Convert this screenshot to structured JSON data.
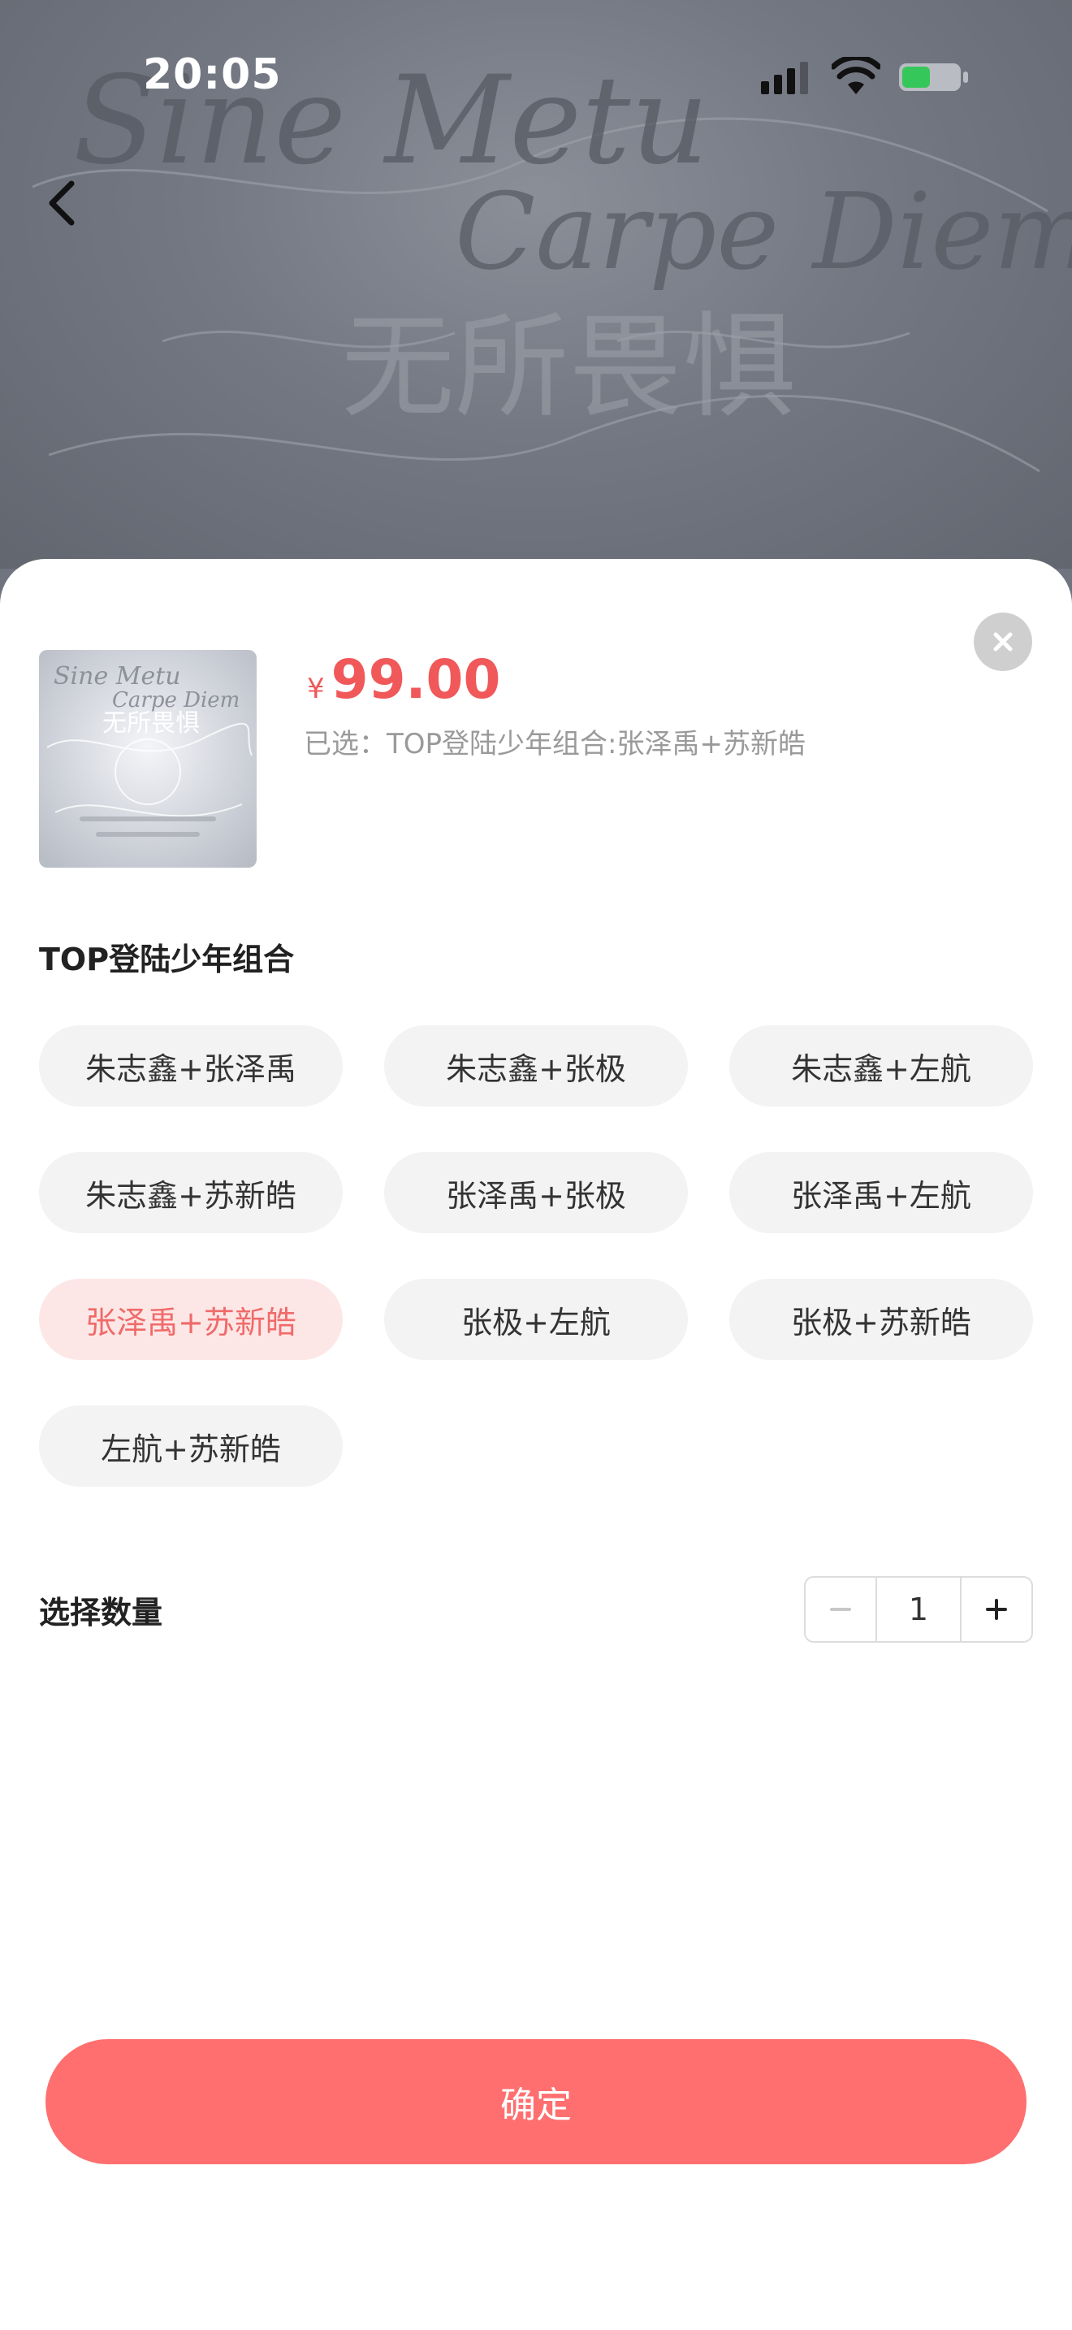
{
  "status_bar": {
    "time": "20:05",
    "icons": [
      "signal-icon",
      "wifi-icon",
      "battery-icon"
    ]
  },
  "header": {
    "back_icon": "chevron-left-icon",
    "background_art": {
      "title_lines": [
        "Sine Metu",
        "Carpe Diem"
      ],
      "chinese_title": "无所畏惧"
    }
  },
  "product": {
    "currency": "¥",
    "price": "99.00",
    "selected_text": "已选：TOP登陆少年组合:张泽禹+苏新皓",
    "thumbnail": {
      "title_lines": [
        "Sine Metu",
        "Carpe Diem"
      ],
      "chinese_title": "无所畏惧"
    }
  },
  "options": {
    "group_title": "TOP登陆少年组合",
    "items": [
      {
        "label": "朱志鑫+张泽禹",
        "selected": false
      },
      {
        "label": "朱志鑫+张极",
        "selected": false
      },
      {
        "label": "朱志鑫+左航",
        "selected": false
      },
      {
        "label": "朱志鑫+苏新皓",
        "selected": false
      },
      {
        "label": "张泽禹+张极",
        "selected": false
      },
      {
        "label": "张泽禹+左航",
        "selected": false
      },
      {
        "label": "张泽禹+苏新皓",
        "selected": true
      },
      {
        "label": "张极+左航",
        "selected": false
      },
      {
        "label": "张极+苏新皓",
        "selected": false
      },
      {
        "label": "左航+苏新皓",
        "selected": false
      }
    ]
  },
  "quantity": {
    "label": "选择数量",
    "value": "1",
    "minus_icon": "minus-icon",
    "plus_icon": "plus-icon"
  },
  "confirm_label": "确定",
  "colors": {
    "accent": "#ff6f6f",
    "price": "#f0585a",
    "selected_chip_bg": "#fde7e6",
    "selected_chip_text": "#f06a6a",
    "chip_bg": "#f3f3f3"
  }
}
